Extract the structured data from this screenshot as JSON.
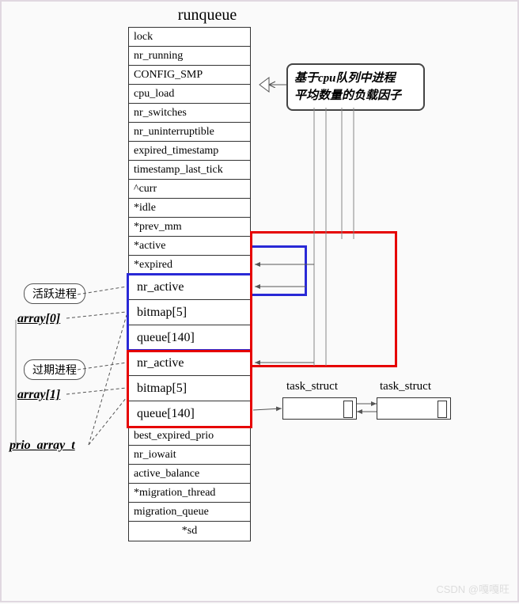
{
  "title": "runqueue",
  "fields": [
    "lock",
    "nr_running",
    "CONFIG_SMP",
    "cpu_load",
    "nr_switches",
    "nr_uninterruptible",
    "expired_timestamp",
    "timestamp_last_tick",
    "^curr",
    "*idle",
    "*prev_mm",
    "*active",
    "*expired"
  ],
  "array0": [
    "nr_active",
    "bitmap[5]",
    "queue[140]"
  ],
  "array1": [
    "nr_active",
    "bitmap[5]",
    "queue[140]"
  ],
  "tail": [
    "best_expired_prio",
    "nr_iowait",
    "active_balance",
    "*migration_thread",
    "migration_queue",
    "*sd"
  ],
  "annotations": {
    "active_proc": "活跃进程",
    "expired_proc": "过期进程",
    "array0_label": "array[0]",
    "array1_label": "array[1]",
    "prio_array": "prio_array_t",
    "note_line1": "基于cpu队列中进程",
    "note_line2": "平均数量的负载因子",
    "task_struct": "task_struct"
  },
  "watermark": "CSDN @嘎嘎旺"
}
